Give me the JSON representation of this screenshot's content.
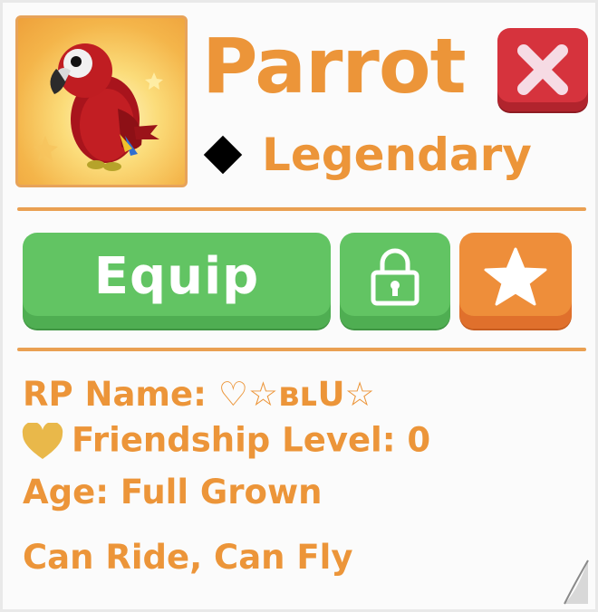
{
  "pet": {
    "name": "Parrot",
    "rarity": "Legendary",
    "portrait_icon": "parrot-icon"
  },
  "actions": {
    "equip_label": "Equip",
    "lock_icon": "lock-icon",
    "favorite_icon": "star-icon",
    "close_icon": "close-icon"
  },
  "details": {
    "rp_name": "RP Name: ♡☆ʙʟU☆",
    "friendship": "Friendship Level: 0",
    "age": "Age: Full Grown",
    "abilities": "Can Ride, Can Fly"
  },
  "colors": {
    "accent": "#ec9539",
    "equip_green": "#62c463",
    "close_red": "#d6333d",
    "favorite_orange": "#ee8e3a",
    "heart_gold": "#e9b84a"
  }
}
